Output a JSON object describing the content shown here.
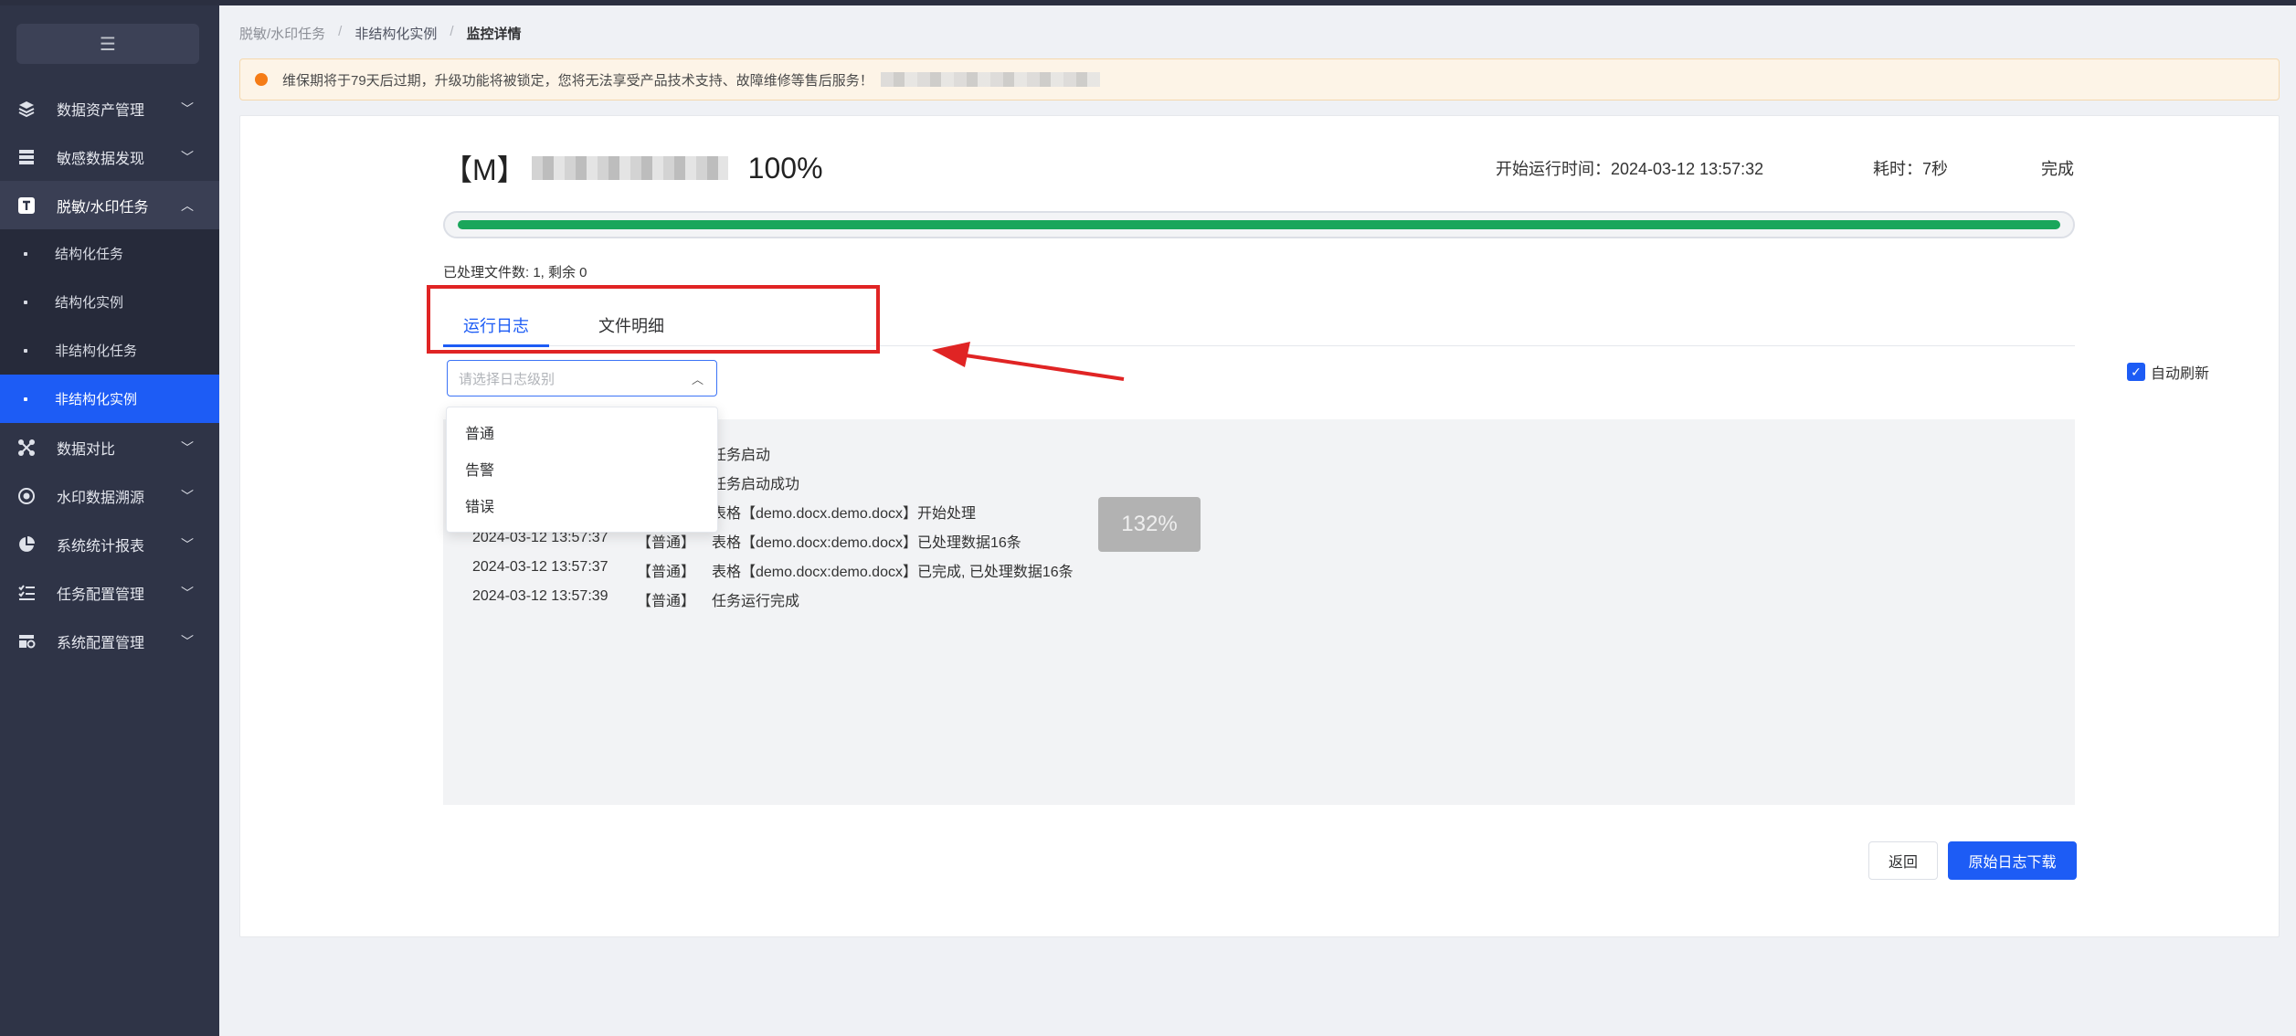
{
  "sidebar": {
    "collapse_icon": "menu-fold-icon",
    "items": [
      {
        "label": "数据资产管理",
        "icon": "layers-icon"
      },
      {
        "label": "敏感数据发现",
        "icon": "database-icon"
      },
      {
        "label": "脱敏/水印任务",
        "icon": "task-t-icon",
        "open": true,
        "children": [
          "结构化任务",
          "结构化实例",
          "非结构化任务",
          "非结构化实例"
        ]
      },
      {
        "label": "数据对比",
        "icon": "compare-icon"
      },
      {
        "label": "水印数据溯源",
        "icon": "target-icon"
      },
      {
        "label": "系统统计报表",
        "icon": "pie-chart-icon"
      },
      {
        "label": "任务配置管理",
        "icon": "list-check-icon"
      },
      {
        "label": "系统配置管理",
        "icon": "settings-table-icon"
      }
    ],
    "active_child": "非结构化实例"
  },
  "breadcrumb": {
    "level1": "脱敏/水印任务",
    "level2": "非结构化实例",
    "current": "监控详情",
    "sep": "/"
  },
  "notice": {
    "text": "维保期将于79天后过期，升级功能将被锁定，您将无法享受产品技术支持、故障维修等售后服务！"
  },
  "header": {
    "title_prefix": "【M】",
    "percent": "100%",
    "start_time_label": "开始运行时间：",
    "start_time": "2024-03-12 13:57:32",
    "duration": "耗时：7秒",
    "status": "完成",
    "progress": 1.0,
    "progress_color": "#1aa65b"
  },
  "processed": "已处理文件数: 1, 剩余 0",
  "tabs": [
    {
      "label": "运行日志",
      "active": true
    },
    {
      "label": "文件明细",
      "active": false
    }
  ],
  "log_level_select": {
    "placeholder": "请选择日志级别",
    "options": [
      "普通",
      "告警",
      "错误"
    ]
  },
  "auto_refresh": {
    "label": "自动刷新",
    "checked": true
  },
  "logs": [
    {
      "time": "",
      "level": "",
      "msg": "任务启动"
    },
    {
      "time": "",
      "level": "",
      "msg": "任务启动成功"
    },
    {
      "time": "",
      "level": "",
      "msg": "表格【demo.docx.demo.docx】开始处理"
    },
    {
      "time": "2024-03-12 13:57:37",
      "level": "【普通】",
      "msg": "表格【demo.docx:demo.docx】已处理数据16条"
    },
    {
      "time": "2024-03-12 13:57:37",
      "level": "【普通】",
      "msg": "表格【demo.docx:demo.docx】已完成, 已处理数据16条"
    },
    {
      "time": "2024-03-12 13:57:39",
      "level": "【普通】",
      "msg": "任务运行完成"
    }
  ],
  "zoom_badge": "132%",
  "buttons": {
    "back": "返回",
    "download": "原始日志下载"
  },
  "colors": {
    "primary": "#1d5cf5",
    "sidebar_bg": "#2f3447",
    "annotation": "#e02424"
  }
}
